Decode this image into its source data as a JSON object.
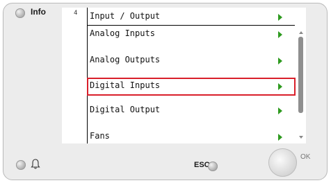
{
  "top_bar": {
    "info_label": "Info",
    "level": "4"
  },
  "menu": {
    "title": "Input / Output",
    "items": [
      {
        "label": "Analog Inputs"
      },
      {
        "label": "Analog Outputs"
      },
      {
        "label": "Digital Inputs",
        "selected": true
      },
      {
        "label": "Digital Output"
      },
      {
        "label": "Fans"
      }
    ]
  },
  "buttons": {
    "esc_label": "ESC",
    "ok_label": "OK"
  },
  "colors": {
    "selection": "#d91f2a",
    "arrow": "#2e9a1f"
  },
  "icons": [
    "info-led-icon",
    "alarm-bell-icon",
    "esc-led-icon",
    "ok-button",
    "arrow-right-icon"
  ]
}
